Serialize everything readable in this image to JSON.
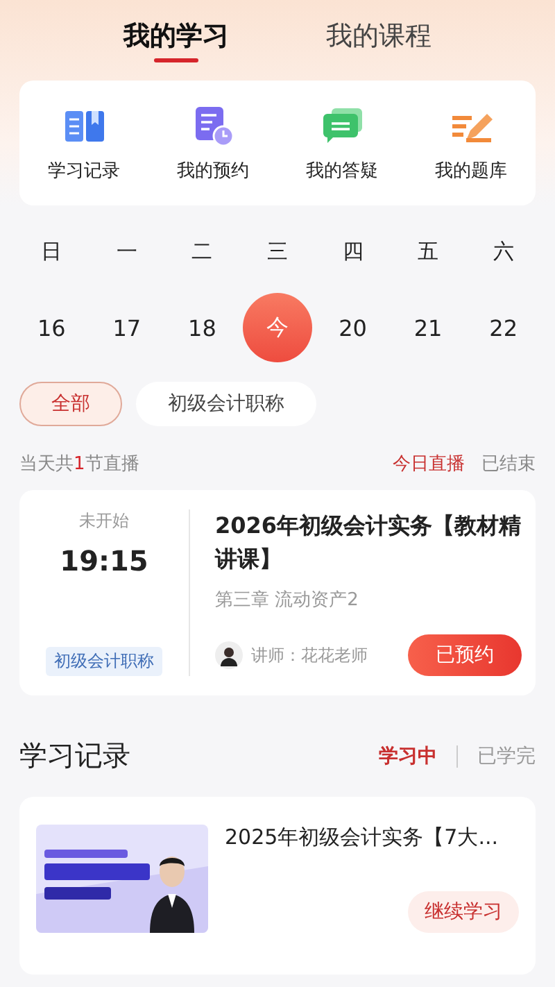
{
  "tabs": [
    {
      "label": "我的学习",
      "selected": true
    },
    {
      "label": "我的课程",
      "selected": false
    }
  ],
  "shortcuts": [
    {
      "label": "学习记录",
      "kind": "book"
    },
    {
      "label": "我的预约",
      "kind": "schedule"
    },
    {
      "label": "我的答疑",
      "kind": "chat"
    },
    {
      "label": "我的题库",
      "kind": "edit"
    }
  ],
  "weekdays": [
    "日",
    "一",
    "二",
    "三",
    "四",
    "五",
    "六"
  ],
  "dates": [
    {
      "label": "16",
      "selected": false
    },
    {
      "label": "17",
      "selected": false
    },
    {
      "label": "18",
      "selected": false
    },
    {
      "label": "今",
      "selected": true
    },
    {
      "label": "20",
      "selected": false
    },
    {
      "label": "21",
      "selected": false
    },
    {
      "label": "22",
      "selected": false
    }
  ],
  "filters": [
    {
      "label": "全部",
      "selected": true
    },
    {
      "label": "初级会计职称",
      "selected": false
    }
  ],
  "summary": {
    "prefix": "当天共",
    "count": "1",
    "suffix": "节直播"
  },
  "live_tabs": [
    {
      "label": "今日直播",
      "selected": true
    },
    {
      "label": "已结束",
      "selected": false
    }
  ],
  "live_card": {
    "status": "未开始",
    "time": "19:15",
    "tag": "初级会计职称",
    "title": "2026年初级会计实务【教材精讲课】",
    "chapter": "第三章 流动资产2",
    "teacher": "讲师：花花老师",
    "button": "已预约"
  },
  "records": {
    "title": "学习记录",
    "tabs": [
      {
        "label": "学习中",
        "selected": true
      },
      {
        "label": "已学完",
        "selected": false
      }
    ],
    "items": [
      {
        "kind": "picture",
        "title": "2025年初级会计实务【7大...",
        "button": "继续学习"
      }
    ]
  }
}
